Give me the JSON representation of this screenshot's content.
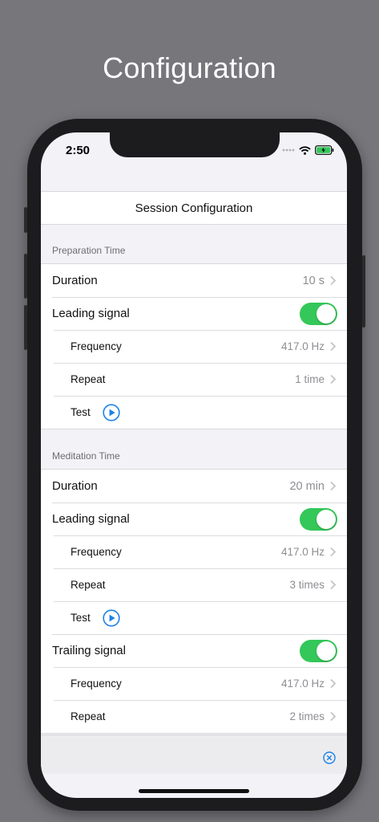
{
  "promo": {
    "title": "Configuration"
  },
  "status_bar": {
    "time": "2:50"
  },
  "nav": {
    "title": "Session Configuration"
  },
  "icons": {
    "chevron": "chevron-right-icon",
    "play": "play-circle-icon",
    "close": "close-circle-icon",
    "wifi": "wifi-icon",
    "battery": "battery-charging-icon",
    "signal": "cellular-signal-icon"
  },
  "colors": {
    "accent": "#1a82e8",
    "toggle_on": "#34c759",
    "secondary_text": "#8e8e93"
  },
  "sections": [
    {
      "header": "Preparation Time",
      "rows": [
        {
          "label": "Duration",
          "value": "10 s"
        },
        {
          "label": "Leading signal",
          "toggle": true
        },
        {
          "label": "Frequency",
          "value": "417.0 Hz"
        },
        {
          "label": "Repeat",
          "value": "1 time"
        },
        {
          "label": "Test"
        }
      ]
    },
    {
      "header": "Meditation Time",
      "rows": [
        {
          "label": "Duration",
          "value": "20 min"
        },
        {
          "label": "Leading signal",
          "toggle": true
        },
        {
          "label": "Frequency",
          "value": "417.0 Hz"
        },
        {
          "label": "Repeat",
          "value": "3 times"
        },
        {
          "label": "Test"
        },
        {
          "label": "Trailing signal",
          "toggle": true
        },
        {
          "label": "Frequency",
          "value": "417.0 Hz"
        },
        {
          "label": "Repeat",
          "value": "2 times"
        }
      ]
    }
  ]
}
